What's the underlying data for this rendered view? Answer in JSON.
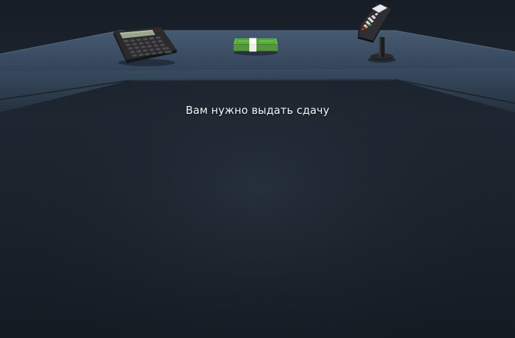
{
  "game": {
    "instruction": "Вам нужно выдать сдачу"
  },
  "counter": {
    "items": [
      {
        "name": "calculator",
        "icon": "calculator-icon"
      },
      {
        "name": "cash-bundle",
        "icon": "banknotes-icon"
      },
      {
        "name": "card-terminal",
        "icon": "pos-terminal-icon"
      }
    ]
  },
  "colors": {
    "counter_top": "#3d5068",
    "counter_edge": "#2c3a4d",
    "floor_top": "#1e2732",
    "floor_bottom": "#141a22",
    "text": "#f2f4f7",
    "cash_green": "#5cb33b"
  }
}
